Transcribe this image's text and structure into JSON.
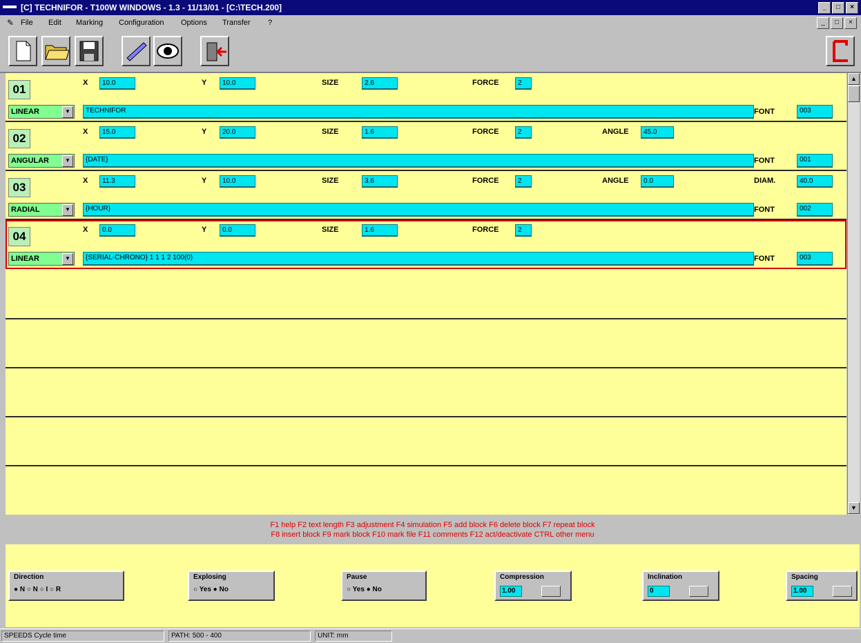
{
  "window": {
    "title": "[C] TECHNIFOR - T100W WINDOWS - 1.3 - 11/13/01 - [C:\\TECH.200]"
  },
  "menu": [
    "File",
    "Edit",
    "Marking",
    "Configuration",
    "Options",
    "Transfer",
    "?"
  ],
  "blocks": [
    {
      "num": "01",
      "x": "10.0",
      "y": "10.0",
      "size": "2.6",
      "force": "2",
      "mode": "LINEAR",
      "text": "TECHNIFOR",
      "font": "003"
    },
    {
      "num": "02",
      "x": "15.0",
      "y": "20.0",
      "size": "1.6",
      "force": "2",
      "angle": "45.0",
      "mode": "ANGULAR",
      "text": "{DATE}",
      "font": "001"
    },
    {
      "num": "03",
      "x": "11.3",
      "y": "10.0",
      "size": "3.6",
      "force": "2",
      "angle": "0.0",
      "diam": "40.0",
      "mode": "RADIAL",
      "text": "{HOUR}",
      "font": "002"
    },
    {
      "num": "04",
      "x": "0.0",
      "y": "0.0",
      "size": "1.6",
      "force": "2",
      "mode": "LINEAR",
      "text": "{SERIAL-CHRONO} 1 1 1 2 100(0)",
      "font": "003"
    }
  ],
  "labels": {
    "x": "X",
    "y": "Y",
    "size": "SIZE",
    "force": "FORCE",
    "angle": "ANGLE",
    "diam": "DIAM.",
    "font": "FONT"
  },
  "help": {
    "line1": "F1 help  F2 text length  F3 adjustment  F4 simulation  F5 add block  F6 delete block  F7 repeat block",
    "line2": "F8 insert block  F9 mark block  F10 mark file  F11 comments  F12 act/deactivate CTRL other menu"
  },
  "options": {
    "direction": {
      "title": "Direction",
      "value": "● N  ○ N  ○ I  ○ R"
    },
    "explosing": {
      "title": "Explosing",
      "value": "○ Yes  ● No"
    },
    "pause": {
      "title": "Pause",
      "value": "○ Yes  ● No"
    },
    "compression": {
      "title": "Compression",
      "value": "1.00"
    },
    "inclination": {
      "title": "Inclination",
      "value": "0"
    },
    "spacing": {
      "title": "Spacing",
      "value": "1.00"
    }
  },
  "status": {
    "s1": "SPEEDS  Cycle time",
    "s2": "PATH: 500 - 400",
    "s3": "UNIT: mm"
  }
}
